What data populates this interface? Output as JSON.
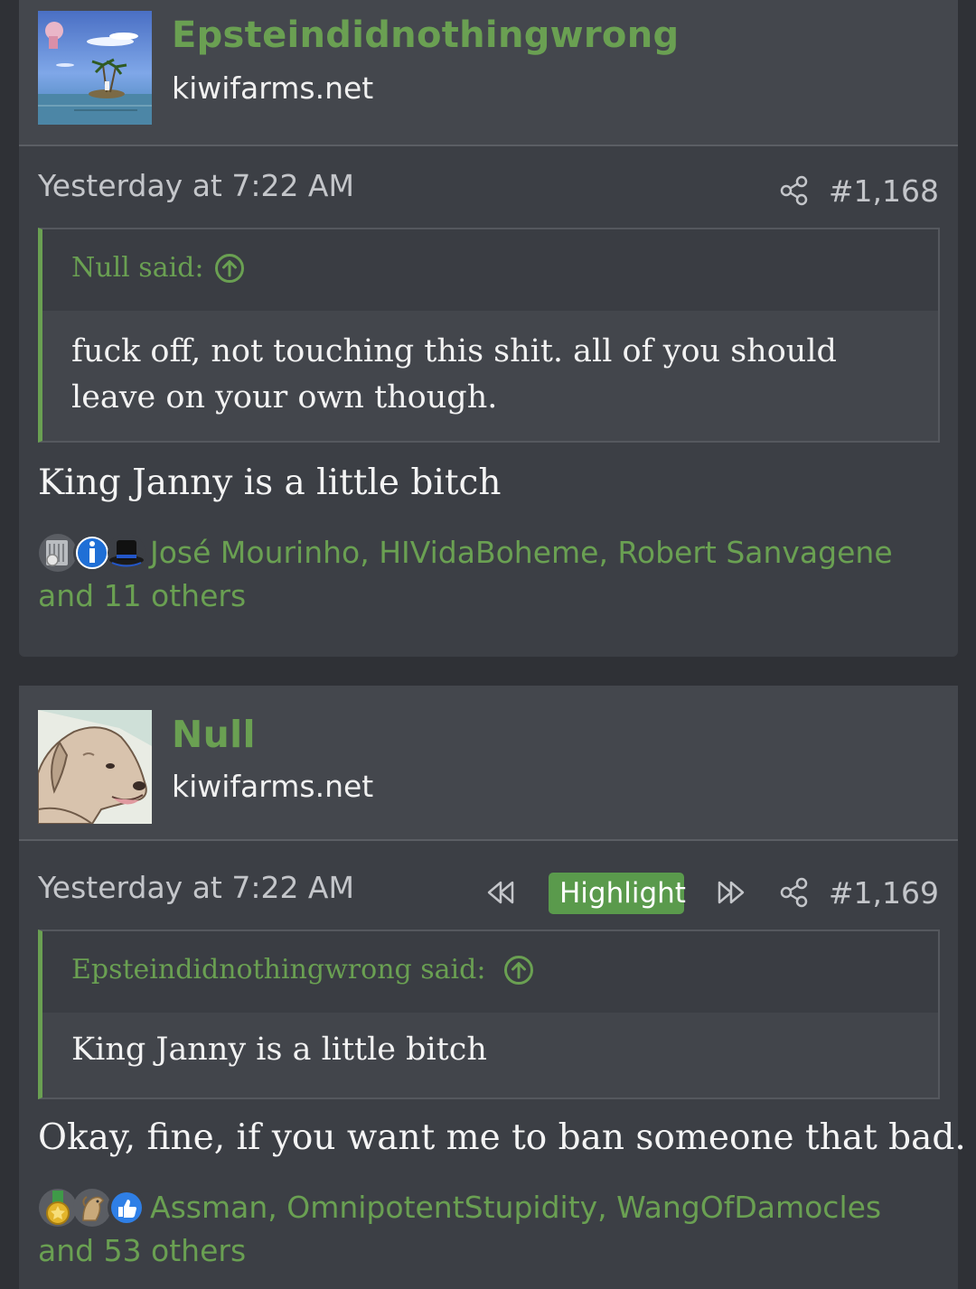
{
  "posts": [
    {
      "username": "Epsteindidnothingwrong",
      "user_title": "kiwifarms.net",
      "avatar_icon": "avatar-island-icon",
      "date": "Yesterday at 7:22 AM",
      "post_number": "#1,168",
      "quote": {
        "author": "Null said:",
        "text": "fuck off, not touching this shit. all of you should leave on your own though."
      },
      "message": "King Janny is a little bitch",
      "reactions": {
        "icons": [
          "semiconductor-chip-icon",
          "informative-icon",
          "top-hat-icon"
        ],
        "text": "José Mourinho, HIVidaBoheme, Robert Sanvagene and 11 others"
      }
    },
    {
      "username": "Null",
      "user_title": "kiwifarms.net",
      "avatar_icon": "avatar-dog-icon",
      "date": "Yesterday at 7:22 AM",
      "highlight_label": "Highlight",
      "post_number": "#1,169",
      "quote": {
        "author": "Epsteindidnothingwrong said:",
        "text": "King Janny is a little bitch"
      },
      "message": "Okay, fine, if you want me to ban someone that bad.",
      "reactions": {
        "icons": [
          "medal-icon",
          "horse-icon",
          "thumbs-up-icon"
        ],
        "text": "Assman, OmnipotentStupidity, WangOfDamocles and 53 others"
      }
    }
  ],
  "colors": {
    "accent_green": "#6aa052",
    "post_bg": "#3c3f45",
    "page_bg": "#2f3136",
    "highlight_bg": "#5a9a4c"
  }
}
